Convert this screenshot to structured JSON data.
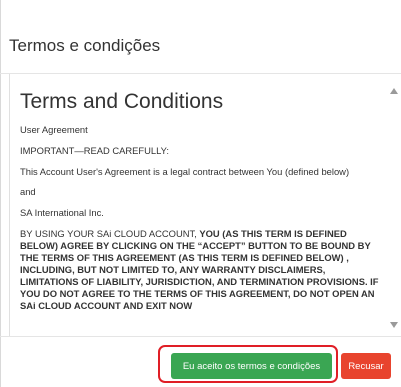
{
  "dialog": {
    "title": "Termos e condições"
  },
  "document": {
    "heading": "Terms and Conditions",
    "paragraphs": [
      "User Agreement",
      "IMPORTANT—READ CAREFULLY:",
      "This Account User's Agreement is a legal contract between You (defined below)",
      "and",
      "SA International Inc."
    ],
    "last_paragraph_normal": "BY USING YOUR SAi CLOUD ACCOUNT, ",
    "last_paragraph_bold": "YOU (AS THIS TERM IS DEFINED BELOW) AGREE BY CLICKING ON THE “ACCEPT” BUTTON TO BE BOUND BY THE TERMS OF THIS AGREEMENT (AS THIS TERM IS DEFINED BELOW) , INCLUDING, BUT NOT LIMITED TO, ANY WARRANTY DISCLAIMERS, LIMITATIONS OF LIABILITY, JURISDICTION, AND TERMINATION PROVISIONS. IF YOU DO NOT AGREE TO THE TERMS OF THIS AGREEMENT, DO NOT OPEN AN SAi CLOUD ACCOUNT AND EXIT NOW"
  },
  "footer": {
    "accept_label": "Eu aceito os termos e condições",
    "refuse_label": "Recusar"
  },
  "colors": {
    "accept_button": "#3aa653",
    "refuse_button": "#e8442e",
    "highlight": "#e01e26"
  }
}
